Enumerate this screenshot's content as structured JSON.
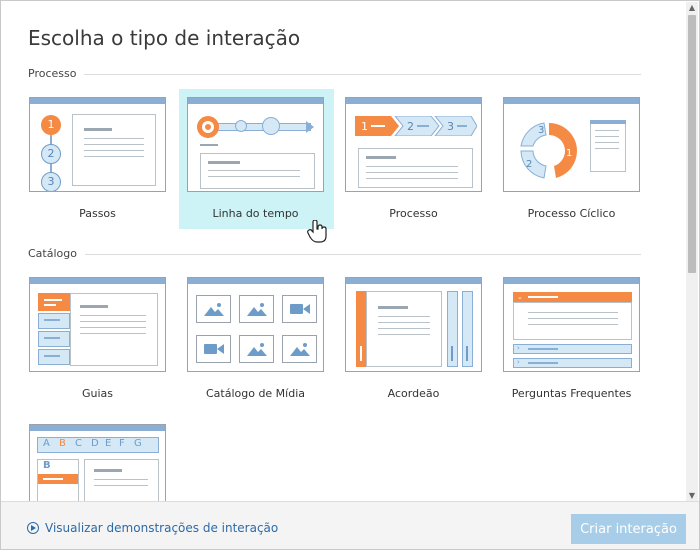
{
  "dialog": {
    "title": "Escolha o tipo de interação"
  },
  "sections": [
    {
      "label": "Processo"
    },
    {
      "label": "Catálogo"
    }
  ],
  "tiles": {
    "passos": {
      "label": "Passos",
      "steps": [
        "1",
        "2",
        "3"
      ]
    },
    "linha_do_tempo": {
      "label": "Linha do tempo"
    },
    "processo": {
      "label": "Processo",
      "steps": [
        "1",
        "2",
        "3"
      ]
    },
    "processo_ciclico": {
      "label": "Processo Cíclico",
      "steps": [
        "1",
        "2",
        "3"
      ]
    },
    "guias": {
      "label": "Guias"
    },
    "catalogo_midia": {
      "label": "Catálogo de Mídia"
    },
    "acordeao": {
      "label": "Acordeão"
    },
    "perguntas": {
      "label": "Perguntas Frequentes"
    },
    "glossario": {
      "letters": [
        "A",
        "B",
        "C",
        "D",
        "E",
        "F",
        "G"
      ],
      "selected_letter": "B"
    }
  },
  "footer": {
    "demo_link": "Visualizar demonstrações de interação",
    "create_button": "Criar interação"
  },
  "colors": {
    "accent": "#f58a45",
    "header_bar": "#8aaed4",
    "selection": "#cdf3f6",
    "button": "#a7cde8",
    "link": "#2d6aa8"
  }
}
